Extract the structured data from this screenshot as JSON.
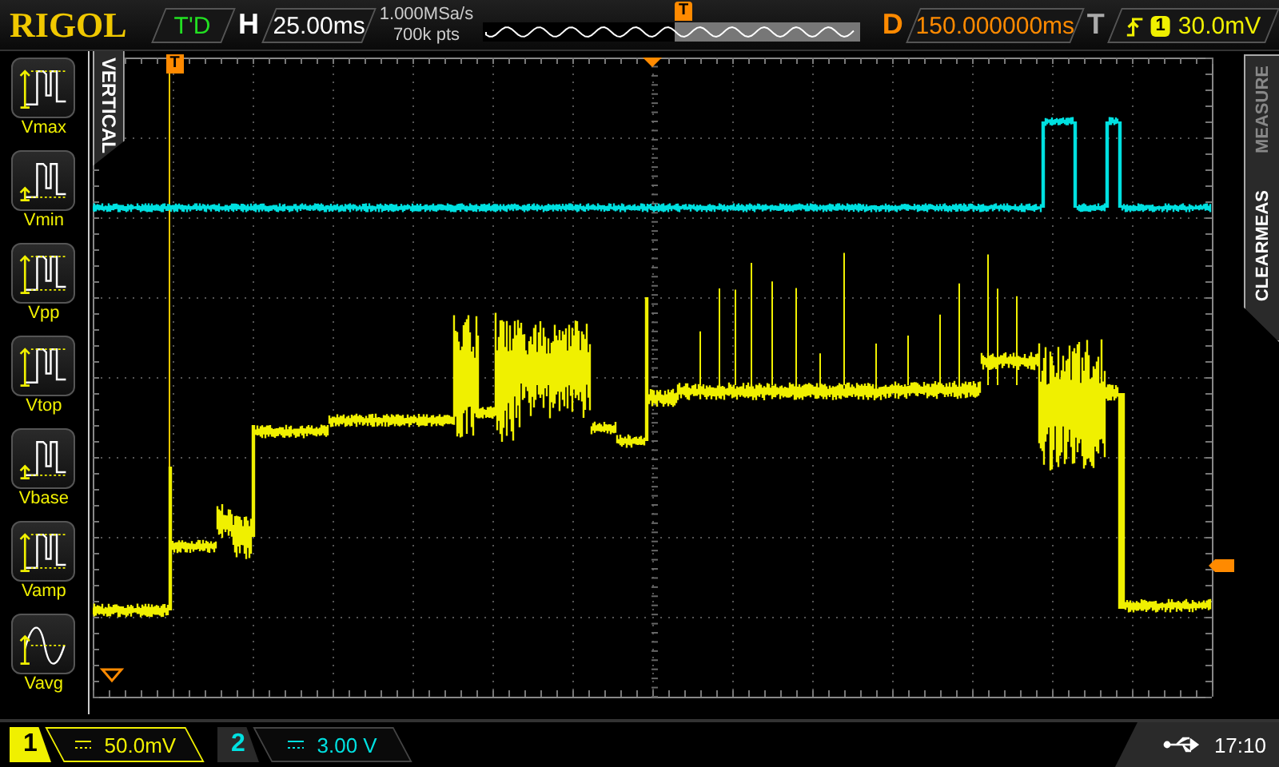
{
  "brand": "RIGOL",
  "run_state": "T'D",
  "horizontal": {
    "label": "H",
    "timebase": "25.00ms"
  },
  "sample": {
    "rate": "1.000MSa/s",
    "depth": "700k pts"
  },
  "memory_marker": "T",
  "delay": {
    "label": "D",
    "value": "150.000000ms"
  },
  "trigger": {
    "label": "T",
    "source": "1",
    "level": "30.0mV"
  },
  "grid_trigger_marker": "T",
  "left_menu": {
    "tab": "VERTICAL",
    "items": [
      {
        "label": "Vmax",
        "kind": "max"
      },
      {
        "label": "Vmin",
        "kind": "min"
      },
      {
        "label": "Vpp",
        "kind": "pp"
      },
      {
        "label": "Vtop",
        "kind": "top"
      },
      {
        "label": "Vbase",
        "kind": "base"
      },
      {
        "label": "Vamp",
        "kind": "amp"
      },
      {
        "label": "Vavg",
        "kind": "avg"
      }
    ]
  },
  "right_tab": {
    "primary": "CLEARMEAS",
    "secondary": "MEASURE"
  },
  "channels": [
    {
      "number": "1",
      "scale": "50.0mV",
      "color": "#f0f000",
      "selected": true
    },
    {
      "number": "2",
      "scale": "3.00 V",
      "color": "#00e0e0",
      "selected": false
    }
  ],
  "status": {
    "time": "17:10"
  }
}
